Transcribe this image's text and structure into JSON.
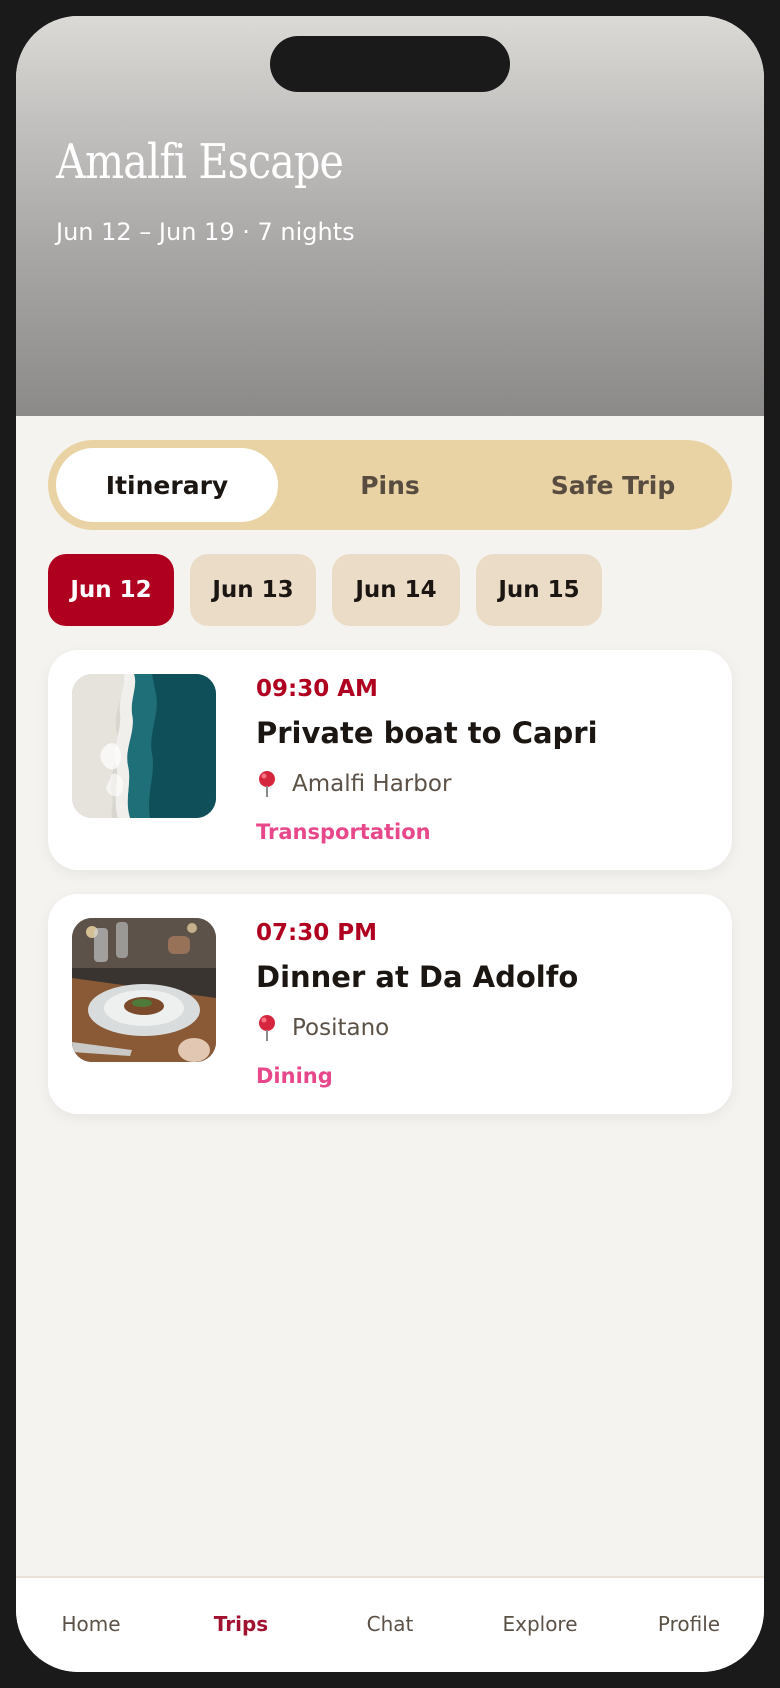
{
  "trip": {
    "title": "Amalfi Escape",
    "subtitle": "Jun 12 – Jun 19 · 7 nights"
  },
  "segments": [
    {
      "label": "Itinerary",
      "active": true
    },
    {
      "label": "Pins",
      "active": false
    },
    {
      "label": "Safe Trip",
      "active": false
    }
  ],
  "days": [
    {
      "label": "Jun 12",
      "active": true
    },
    {
      "label": "Jun 13",
      "active": false
    },
    {
      "label": "Jun 14",
      "active": false
    },
    {
      "label": "Jun 15",
      "active": false
    }
  ],
  "events": [
    {
      "time": "09:30 AM",
      "title": "Private boat to Capri",
      "location": "Amalfi Harbor",
      "category": "Transportation",
      "image": "sea-aerial-photo",
      "location_icon": "map-pin-icon"
    },
    {
      "time": "07:30 PM",
      "title": "Dinner at Da Adolfo",
      "location": "Positano",
      "category": "Dining",
      "image": "dinner-plate-photo",
      "location_icon": "map-pin-icon"
    }
  ],
  "tabbar": [
    {
      "label": "Home",
      "active": false
    },
    {
      "label": "Trips",
      "active": true
    },
    {
      "label": "Chat",
      "active": false
    },
    {
      "label": "Explore",
      "active": false
    },
    {
      "label": "Profile",
      "active": false
    }
  ],
  "colors": {
    "accent": "#b00020",
    "segment_bg": "#e9d3a4",
    "day_chip_bg": "#ebdcc7",
    "category": "#e8478a",
    "background": "#f5f3ef",
    "tab_active": "#a01230"
  }
}
